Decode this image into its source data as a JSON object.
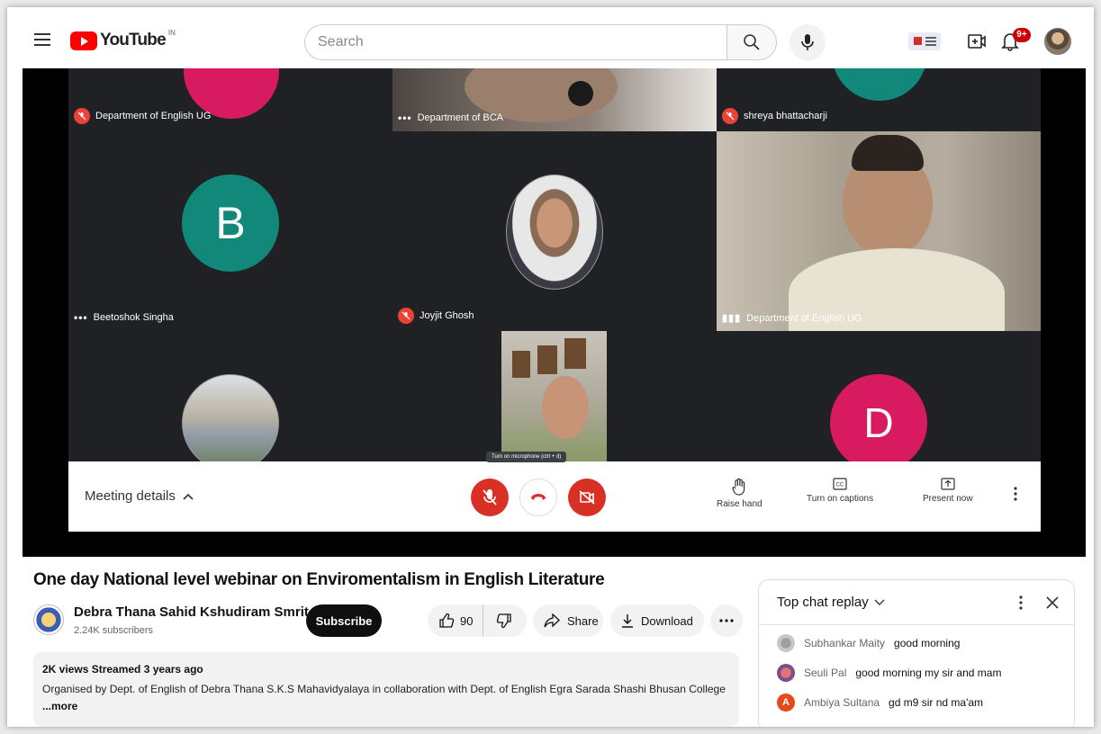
{
  "topbar": {
    "logo_text": "YouTube",
    "region": "IN",
    "search_placeholder": "Search",
    "notifications_badge": "9+"
  },
  "meet": {
    "tiles": [
      {
        "name": "Department of English UG",
        "status": "muted"
      },
      {
        "name": "Department of BCA",
        "status": "speaking-dots"
      },
      {
        "name": "shreya bhattacharji",
        "status": "muted"
      },
      {
        "name": "Beetoshok Singha",
        "status": "speaking-dots",
        "initial": "B"
      },
      {
        "name": "Joyjit Ghosh",
        "status": "muted"
      },
      {
        "name": "Department of English UG",
        "status": "speaking"
      },
      {
        "name": "",
        "initial": "D"
      }
    ],
    "meeting_details_label": "Meeting details",
    "tooltip": "Turn on microphone (ctrl + d)",
    "raise_hand_label": "Raise hand",
    "captions_label": "Turn on captions",
    "present_label": "Present now"
  },
  "video": {
    "title": "One day National level webinar on Enviromentalism in English Literature",
    "channel_name": "Debra Thana Sahid Kshudiram Smrit...",
    "subscribers": "2.24K subscribers",
    "subscribe_label": "Subscribe",
    "likes": "90",
    "share_label": "Share",
    "download_label": "Download",
    "views_meta": "2K views  Streamed 3 years ago",
    "description": "Organised by Dept. of English of Debra Thana S.K.S Mahavidyalaya in collaboration with Dept. of English Egra Sarada Shashi Bhusan College",
    "more_label": "...more"
  },
  "chat": {
    "header": "Top chat replay",
    "messages": [
      {
        "author": "Subhankar Maity",
        "text": "good morning"
      },
      {
        "author": "Seuli Pal",
        "text": "good morning my sir and mam"
      },
      {
        "author": "Ambiya Sultana",
        "text": "gd m9 sir nd ma'am",
        "initial": "A"
      }
    ]
  },
  "colors": {
    "brand_red": "#ff0000",
    "meet_red": "#ea4335",
    "meet_bg": "#202124",
    "teal": "#12887a",
    "pink": "#d81b60"
  }
}
